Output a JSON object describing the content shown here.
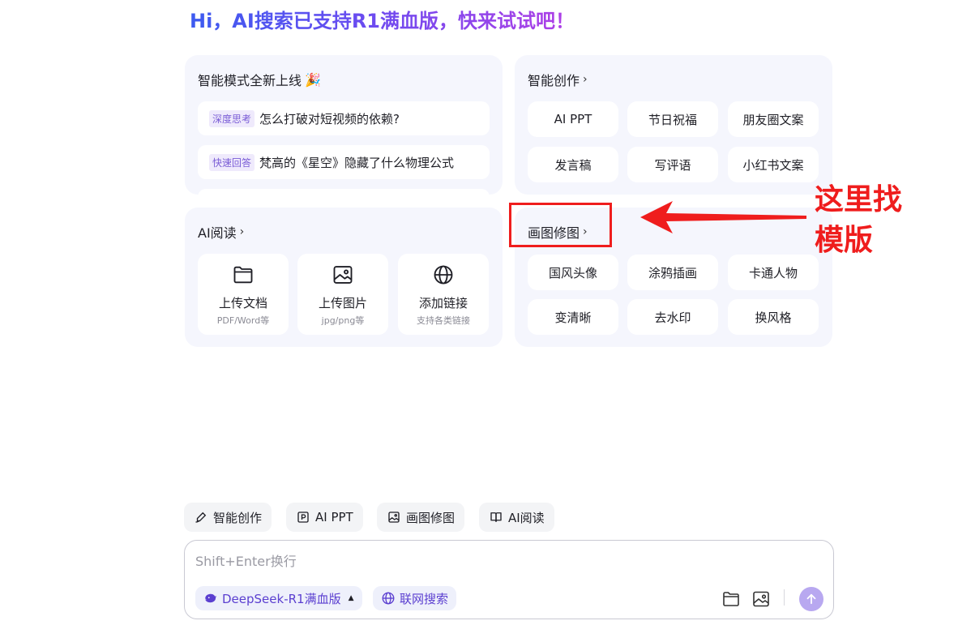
{
  "headline": "Hi，AI搜索已支持R1满血版，快来试试吧！",
  "smart_mode": {
    "title": "智能模式全新上线",
    "title_emoji": "🎉",
    "items": [
      {
        "tag": "深度思考",
        "text": "怎么打破对短视频的依赖?"
      },
      {
        "tag": "快速回答",
        "text": "梵高的《星空》隐藏了什么物理公式"
      }
    ]
  },
  "creation": {
    "title": "智能创作",
    "items": [
      "AI PPT",
      "节日祝福",
      "朋友圈文案",
      "发言稿",
      "写评语",
      "小红书文案"
    ]
  },
  "reading": {
    "title": "AI阅读",
    "items": [
      {
        "label": "上传文档",
        "sub": "PDF/Word等",
        "icon": "folder-icon"
      },
      {
        "label": "上传图片",
        "sub": "jpg/png等",
        "icon": "image-icon"
      },
      {
        "label": "添加链接",
        "sub": "支持各类链接",
        "icon": "globe-icon"
      }
    ]
  },
  "image_edit": {
    "title": "画图修图",
    "items": [
      "国风头像",
      "涂鸦插画",
      "卡通人物",
      "变清晰",
      "去水印",
      "换风格"
    ]
  },
  "annotation": {
    "line1": "这里找",
    "line2": "模版",
    "color": "#ef1d1d"
  },
  "quick_bar": [
    {
      "label": "智能创作",
      "icon": "pen-icon"
    },
    {
      "label": "AI PPT",
      "icon": "ppt-icon"
    },
    {
      "label": "画图修图",
      "icon": "image-edit-icon"
    },
    {
      "label": "AI阅读",
      "icon": "book-icon"
    }
  ],
  "input": {
    "placeholder": "Shift+Enter换行",
    "model_label": "DeepSeek-R1满血版",
    "web_search_label": "联网搜索"
  },
  "colors": {
    "accent": "#5b3fd0",
    "card_bg": "#f5f6fd",
    "send_button": "#b8a8f0"
  }
}
